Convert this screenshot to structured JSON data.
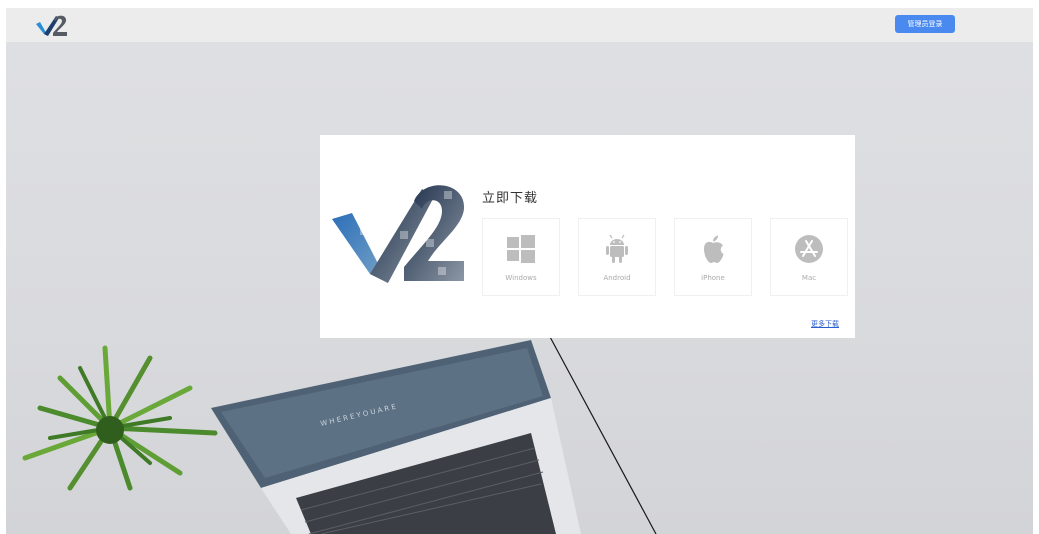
{
  "header": {
    "admin_login_label": "管理员登录"
  },
  "download_card": {
    "title": "立即下载",
    "platforms": [
      {
        "label": "Windows",
        "icon": "windows-icon"
      },
      {
        "label": "Android",
        "icon": "android-icon"
      },
      {
        "label": "iPhone",
        "icon": "apple-icon"
      },
      {
        "label": "Mac",
        "icon": "app-store-icon"
      }
    ],
    "more_downloads_label": "更多下载"
  },
  "colors": {
    "accent": "#4a8af0",
    "link": "#2a5fd0",
    "icon_gray": "#bdbdbd",
    "background": "#dcdddf"
  }
}
